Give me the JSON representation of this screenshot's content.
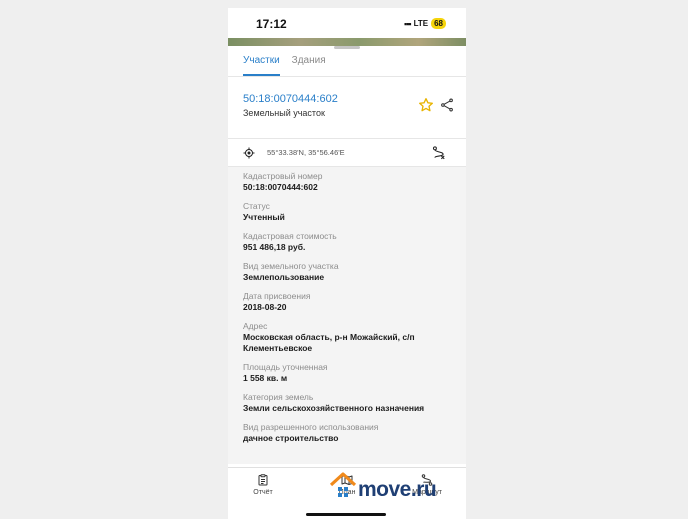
{
  "status": {
    "time": "17:12",
    "network": "LTE",
    "battery": "68"
  },
  "tabs": [
    {
      "label": "Участки",
      "active": true
    },
    {
      "label": "Здания",
      "active": false
    }
  ],
  "plot": {
    "cadastral_number": "50:18:0070444:602",
    "type": "Земельный участок"
  },
  "location": {
    "coordinates": "55°33.38'N, 35°56.46'E"
  },
  "fields": [
    {
      "label": "Кадастровый номер",
      "value": "50:18:0070444:602"
    },
    {
      "label": "Статус",
      "value": "Учтенный"
    },
    {
      "label": "Кадастровая стоимость",
      "value": "951 486,18 руб."
    },
    {
      "label": "Вид земельного участка",
      "value": "Землепользование"
    },
    {
      "label": "Дата присвоения",
      "value": "2018-08-20"
    },
    {
      "label": "Адрес",
      "value": "Московская область, р-н Можайский, с/п Клементьевское"
    },
    {
      "label": "Площадь уточненная",
      "value": "1 558 кв. м"
    },
    {
      "label": "Категория земель",
      "value": "Земли сельскохозяйственного назначения"
    },
    {
      "label": "Вид разрешенного использования",
      "value": "дачное строительство"
    }
  ],
  "bottom_nav": [
    {
      "label": "Отчёт",
      "icon": "report-icon"
    },
    {
      "label": "План",
      "icon": "map-icon"
    },
    {
      "label": "Маршрут",
      "icon": "route-icon"
    }
  ],
  "watermark": {
    "text": "move.ru"
  },
  "colors": {
    "accent": "#2a7fc9",
    "star": "#e8b400",
    "watermark": "#1f3f74",
    "watermark_roof": "#f08a1c"
  }
}
